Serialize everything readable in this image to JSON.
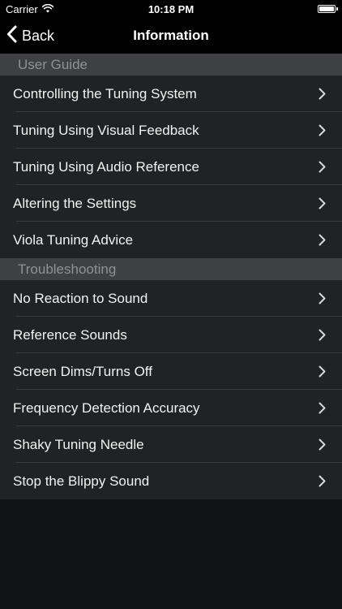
{
  "status_bar": {
    "carrier": "Carrier",
    "time": "10:18 PM"
  },
  "nav": {
    "back_label": "Back",
    "title": "Information"
  },
  "sections": [
    {
      "header": "User Guide",
      "items": [
        {
          "label": "Controlling the Tuning System"
        },
        {
          "label": "Tuning Using Visual Feedback"
        },
        {
          "label": "Tuning Using Audio Reference"
        },
        {
          "label": "Altering the Settings"
        },
        {
          "label": "Viola Tuning Advice"
        }
      ]
    },
    {
      "header": "Troubleshooting",
      "items": [
        {
          "label": "No Reaction to Sound"
        },
        {
          "label": "Reference Sounds"
        },
        {
          "label": "Screen Dims/Turns Off"
        },
        {
          "label": "Frequency Detection Accuracy"
        },
        {
          "label": "Shaky Tuning Needle"
        },
        {
          "label": "Stop the Blippy Sound"
        }
      ]
    }
  ],
  "colors": {
    "background": "#121314",
    "bar": "#000000",
    "section_header_bg": "#3e4042",
    "section_header_text": "#8f9194",
    "row_bg": "#202223",
    "row_text": "#f2f2f2",
    "separator": "#3a3c3e"
  },
  "icons": {
    "wifi": "wifi-icon",
    "battery": "battery-icon",
    "back": "chevron-left-icon",
    "disclosure": "chevron-right-icon"
  }
}
